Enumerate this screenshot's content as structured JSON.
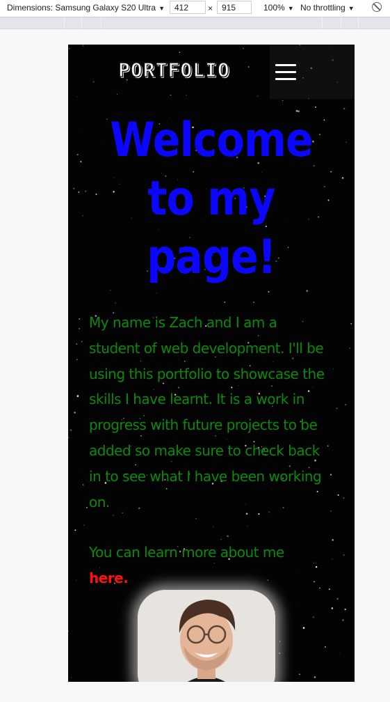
{
  "devtools": {
    "dimensions_label": "Dimensions: Samsung Galaxy S20 Ultra",
    "width_value": "412",
    "times_sign": "×",
    "height_value": "915",
    "zoom": "100%",
    "throttling": "No throttling"
  },
  "site": {
    "logo": "PORTFOLIO",
    "hero_title": "Welcome to my page!",
    "intro": "My name is Zach and I am a student of web development. I'll be using this portfolio to showcase the skills I have learnt. It is a work in progress with future projects to be added so make sure to check back in to see what I have been working on.",
    "learn_more_prefix": "You can learn more about me",
    "learn_more_link": "here."
  },
  "colors": {
    "title": "#0a06ff",
    "body_text": "#0b8a0b",
    "link": "#ff1010",
    "background": "#030303"
  },
  "icons": [
    "hamburger-menu-icon",
    "rotate-block-icon",
    "caret-down-icon"
  ]
}
